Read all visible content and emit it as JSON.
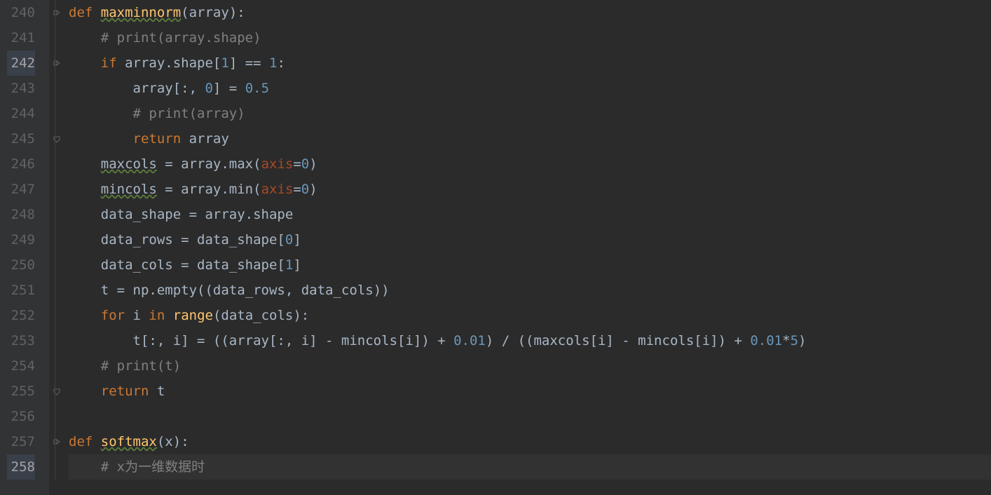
{
  "lines": [
    {
      "num": "240",
      "tokens": [
        [
          "kw",
          "def "
        ],
        [
          "fn underline-green",
          "maxminnorm"
        ],
        [
          "paren",
          "("
        ],
        [
          "var",
          "array"
        ],
        [
          "paren",
          "):"
        ]
      ],
      "indent": 0,
      "fold": "down"
    },
    {
      "num": "241",
      "tokens": [
        [
          "comment",
          "# print(array.shape)"
        ]
      ],
      "indent": 1
    },
    {
      "num": "242",
      "tokens": [
        [
          "kw",
          "if "
        ],
        [
          "var",
          "array.shape["
        ],
        [
          "num",
          "1"
        ],
        [
          "var",
          "] == "
        ],
        [
          "num",
          "1"
        ],
        [
          "var",
          ":"
        ]
      ],
      "indent": 1,
      "fold": "down",
      "active": true
    },
    {
      "num": "243",
      "tokens": [
        [
          "var",
          "array[:, "
        ],
        [
          "num",
          "0"
        ],
        [
          "var",
          "] = "
        ],
        [
          "num",
          "0.5"
        ]
      ],
      "indent": 2
    },
    {
      "num": "244",
      "tokens": [
        [
          "comment",
          "# print(array)"
        ]
      ],
      "indent": 2
    },
    {
      "num": "245",
      "tokens": [
        [
          "kw",
          "return "
        ],
        [
          "var",
          "array"
        ]
      ],
      "indent": 2,
      "fold": "up"
    },
    {
      "num": "246",
      "tokens": [
        [
          "var underline-green",
          "maxcols"
        ],
        [
          "var",
          " = array.max("
        ],
        [
          "param",
          "axis"
        ],
        [
          "var",
          "="
        ],
        [
          "num",
          "0"
        ],
        [
          "var",
          ")"
        ]
      ],
      "indent": 1
    },
    {
      "num": "247",
      "tokens": [
        [
          "var underline-green",
          "mincols"
        ],
        [
          "var",
          " = array.min("
        ],
        [
          "param",
          "axis"
        ],
        [
          "var",
          "="
        ],
        [
          "num",
          "0"
        ],
        [
          "var",
          ")"
        ]
      ],
      "indent": 1
    },
    {
      "num": "248",
      "tokens": [
        [
          "var",
          "data_shape = array.shape"
        ]
      ],
      "indent": 1
    },
    {
      "num": "249",
      "tokens": [
        [
          "var",
          "data_rows = data_shape["
        ],
        [
          "num",
          "0"
        ],
        [
          "var",
          "]"
        ]
      ],
      "indent": 1
    },
    {
      "num": "250",
      "tokens": [
        [
          "var",
          "data_cols = data_shape["
        ],
        [
          "num",
          "1"
        ],
        [
          "var",
          "]"
        ]
      ],
      "indent": 1
    },
    {
      "num": "251",
      "tokens": [
        [
          "var",
          "t = np.empty((data_rows, data_cols))"
        ]
      ],
      "indent": 1
    },
    {
      "num": "252",
      "tokens": [
        [
          "kw",
          "for "
        ],
        [
          "var",
          "i "
        ],
        [
          "kw",
          "in "
        ],
        [
          "fn",
          "range"
        ],
        [
          "var",
          "(data_cols):"
        ]
      ],
      "indent": 1
    },
    {
      "num": "253",
      "tokens": [
        [
          "var",
          "t[:, i] = ((array[:, i] - mincols[i]) + "
        ],
        [
          "num",
          "0.01"
        ],
        [
          "var",
          ") / ((maxcols[i] - mincols[i]) + "
        ],
        [
          "num",
          "0.01"
        ],
        [
          "var",
          "*"
        ],
        [
          "num",
          "5"
        ],
        [
          "var",
          ")"
        ]
      ],
      "indent": 2
    },
    {
      "num": "254",
      "tokens": [
        [
          "comment",
          "# print(t)"
        ]
      ],
      "indent": 1
    },
    {
      "num": "255",
      "tokens": [
        [
          "kw",
          "return "
        ],
        [
          "var",
          "t"
        ]
      ],
      "indent": 1,
      "fold": "up"
    },
    {
      "num": "256",
      "tokens": [
        [
          "var",
          ""
        ]
      ],
      "indent": 0
    },
    {
      "num": "257",
      "tokens": [
        [
          "kw",
          "def "
        ],
        [
          "fn underline-green",
          "softmax"
        ],
        [
          "paren",
          "("
        ],
        [
          "var",
          "x"
        ],
        [
          "paren",
          "):"
        ]
      ],
      "indent": 0,
      "fold": "down"
    },
    {
      "num": "258",
      "tokens": [
        [
          "comment",
          "# x为一维数据时"
        ]
      ],
      "indent": 1,
      "caret": true
    }
  ],
  "indentSize": "    "
}
